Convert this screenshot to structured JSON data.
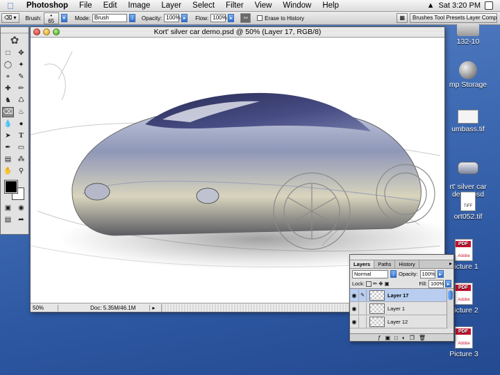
{
  "menubar": {
    "app": "Photoshop",
    "items": [
      "File",
      "Edit",
      "Image",
      "Layer",
      "Select",
      "Filter",
      "View",
      "Window",
      "Help"
    ],
    "clock": "Sat 3:20 PM"
  },
  "options": {
    "brush_label": "Brush:",
    "brush_size": "65",
    "mode_label": "Mode:",
    "mode_value": "Brush",
    "opacity_label": "Opacity:",
    "opacity_value": "100%",
    "flow_label": "Flow:",
    "flow_value": "100%",
    "erase_history": "Erase to History",
    "well_tabs": "Brushes Tool Presets Layer Comps"
  },
  "document": {
    "title": "Kort' silver car demo.psd @ 50% (Layer 17, RGB/8)",
    "zoom": "50%",
    "doc_info": "Doc: 5.35M/46.1M"
  },
  "desktop": {
    "icons": [
      {
        "label": "132-10",
        "icon": "disk-icon"
      },
      {
        "label": "mp Storage",
        "icon": "network-icon"
      },
      {
        "label": "umbass.tif",
        "icon": "image-file-icon"
      },
      {
        "label": "rt' silver car\ndemo.psd",
        "icon": "psd-file-icon"
      },
      {
        "label": "ort052.tif",
        "icon": "tiff-file-icon"
      },
      {
        "label": "Picture 1",
        "icon": "pdf-icon"
      },
      {
        "label": "Picture 2",
        "icon": "pdf-icon"
      },
      {
        "label": "Picture 3",
        "icon": "pdf-icon"
      }
    ]
  },
  "layers_palette": {
    "tabs": [
      "Layers",
      "Paths",
      "History"
    ],
    "blend_mode": "Normal",
    "opacity_label": "Opacity:",
    "opacity_value": "100%",
    "lock_label": "Lock:",
    "fill_label": "Fill:",
    "fill_value": "100%",
    "layers": [
      {
        "name": "Layer 17",
        "selected": true
      },
      {
        "name": "Layer 1",
        "selected": false
      },
      {
        "name": "Layer 12",
        "selected": false
      }
    ]
  },
  "colors": {
    "accent": "#3a74d8",
    "selection": "#b8cdef",
    "foreground": "#000000",
    "background": "#ffffff"
  }
}
